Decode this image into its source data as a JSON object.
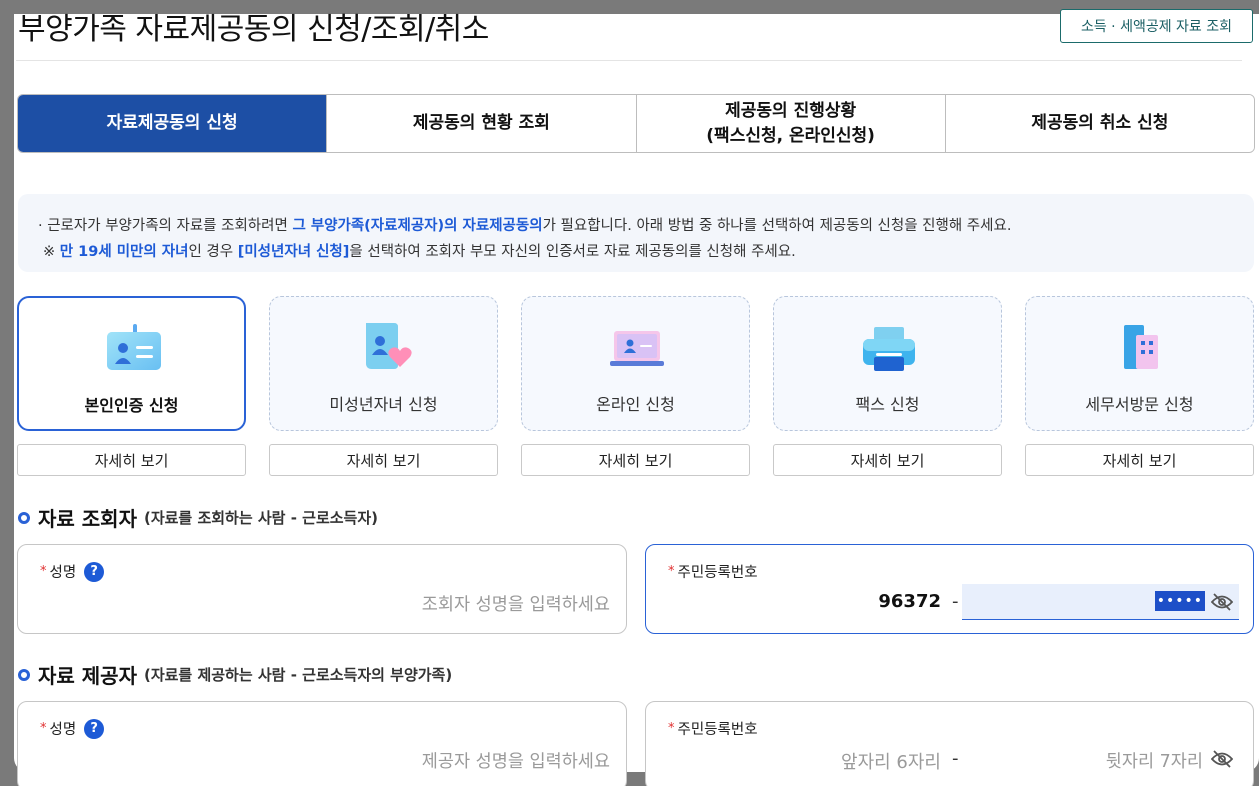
{
  "header": {
    "title": "부양가족 자료제공동의 신청/조회/취소",
    "top_button": "소득 · 세액공제 자료 조회"
  },
  "tabs": [
    {
      "label": "자료제공동의 신청",
      "active": true
    },
    {
      "label": "제공동의 현황 조회"
    },
    {
      "label": "제공동의 진행상황",
      "label2": "(팩스신청, 온라인신청)"
    },
    {
      "label": "제공동의 취소 신청"
    }
  ],
  "notice": {
    "line1_a": "근로자가 부양가족의 자료를 조회하려면 ",
    "line1_hl": "그 부양가족(자료제공자)의 자료제공동의",
    "line1_b": "가 필요합니다. 아래 방법 중 하나를 선택하여 제공동의 신청을 진행해 주세요.",
    "line2_mark": "※ ",
    "line2_hl1": "만 19세 미만의 자녀",
    "line2_a": "인 경우 ",
    "line2_hl2": "[미성년자녀 신청]",
    "line2_b": "을 선택하여 조회자 부모 자신의 인증서로 자료 제공동의를 신청해 주세요."
  },
  "methods": [
    {
      "label": "본인인증 신청",
      "icon": "id-card-icon",
      "selected": true
    },
    {
      "label": "미성년자녀 신청",
      "icon": "child-heart-icon"
    },
    {
      "label": "온라인 신청",
      "icon": "laptop-icon"
    },
    {
      "label": "팩스 신청",
      "icon": "fax-printer-icon"
    },
    {
      "label": "세무서방문 신청",
      "icon": "building-icon"
    }
  ],
  "detail_label": "자세히 보기",
  "viewer": {
    "heading": "자료 조회자",
    "sub": "(자료를 조회하는 사람 - 근로소득자)",
    "name_label": "성명",
    "name_placeholder": "조회자 성명을 입력하세요",
    "rrn_label": "주민등록번호",
    "rrn_front": "96372",
    "rrn_dash": "-",
    "rrn_back_masked": "•••••"
  },
  "provider": {
    "heading": "자료 제공자",
    "sub": "(자료를 제공하는 사람 - 근로소득자의 부양가족)",
    "name_label": "성명",
    "name_placeholder": "제공자 성명을 입력하세요",
    "rrn_label": "주민등록번호",
    "rrn_front_placeholder": "앞자리 6자리",
    "rrn_dash": "-",
    "rrn_back_placeholder": "뒷자리 7자리"
  },
  "misc": {
    "required_mark": "*",
    "help_mark": "?",
    "bullet": "·"
  },
  "colors": {
    "primary": "#1d4fa5",
    "accent": "#2a62d6",
    "highlight": "#1d5ad6",
    "required": "#e03030"
  }
}
